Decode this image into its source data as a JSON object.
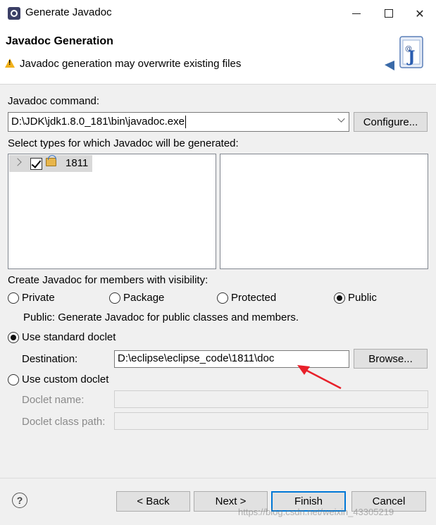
{
  "window": {
    "title": "Generate Javadoc",
    "controls": [
      "minimize",
      "maximize",
      "close"
    ]
  },
  "header": {
    "title": "Javadoc Generation",
    "warning": "Javadoc generation may overwrite existing files",
    "warning_icon": "warning-icon",
    "banner_icon": "javadoc-wizard-icon"
  },
  "javadoc_command": {
    "label": "Javadoc command:",
    "value": "D:\\JDK\\jdk1.8.0_181\\bin\\javadoc.exe",
    "configure_label": "Configure..."
  },
  "types": {
    "label": "Select types for which Javadoc will be generated:",
    "tree": [
      {
        "label": "1811",
        "checked": true,
        "expanded": false
      }
    ]
  },
  "visibility": {
    "label": "Create Javadoc for members with visibility:",
    "options": [
      "Private",
      "Package",
      "Protected",
      "Public"
    ],
    "selected": "Public",
    "description": "Public: Generate Javadoc for public classes and members."
  },
  "doclet": {
    "standard_label": "Use standard doclet",
    "standard_selected": true,
    "destination_label": "Destination:",
    "destination_value": "D:\\eclipse\\eclipse_code\\1811\\doc",
    "browse_label": "Browse...",
    "custom_label": "Use custom doclet",
    "custom_selected": false,
    "doclet_name_label": "Doclet name:",
    "doclet_class_path_label": "Doclet class path:"
  },
  "footer": {
    "help_glyph": "?",
    "back_label": "< Back",
    "next_label": "Next >",
    "finish_label": "Finish",
    "cancel_label": "Cancel",
    "watermark": "https://blog.csdn.net/weixin_43305219"
  },
  "colors": {
    "accent": "#0078d7",
    "annotation_arrow": "#e8202a",
    "warning": "#f2b21b"
  }
}
